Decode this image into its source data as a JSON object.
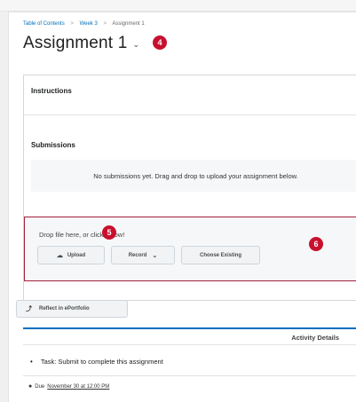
{
  "breadcrumb": {
    "items": [
      "Table of Contents",
      "Week 3",
      "Assignment 1"
    ],
    "separator": ">"
  },
  "page": {
    "title": "Assignment 1",
    "title_chevron": "⌄"
  },
  "instructions": {
    "heading": "Instructions"
  },
  "submissions": {
    "heading": "Submissions",
    "empty_message": "No submissions yet. Drag and drop to upload your assignment below."
  },
  "dropzone": {
    "text": "Drop file here, or click below!",
    "upload_label": "Upload",
    "record_label": "Record",
    "choose_existing_label": "Choose Existing"
  },
  "portfolio": {
    "label": "Reflect in ePortfolio"
  },
  "activity": {
    "header": "Activity Details",
    "task": "Task: Submit to complete this assignment",
    "due_prefix": "Due",
    "due_date": "November 30 at 12:00 PM"
  },
  "badges": {
    "b4": "4",
    "b5": "5",
    "b6": "6"
  },
  "colors": {
    "accent": "#006fbf",
    "badge": "#c8102e",
    "dropzone_border": "#a3203a"
  },
  "icons": {
    "upload": "cloud-upload-icon",
    "record_caret": "chevron-down-icon",
    "portfolio": "portfolio-icon",
    "due": "clock-icon"
  }
}
